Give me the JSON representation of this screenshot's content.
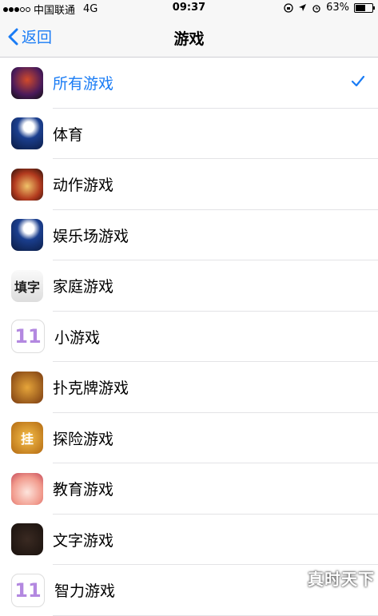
{
  "status": {
    "carrier": "中国联通",
    "network": "4G",
    "time": "09:37",
    "battery": "63%",
    "battery_level": 0.63
  },
  "nav": {
    "back_label": "返回",
    "title": "游戏"
  },
  "items": [
    {
      "label": "所有游戏",
      "icon": "all-games-icon",
      "selected": true
    },
    {
      "label": "体育",
      "icon": "sports-icon"
    },
    {
      "label": "动作游戏",
      "icon": "action-games-icon"
    },
    {
      "label": "娱乐场游戏",
      "icon": "casino-games-icon"
    },
    {
      "label": "家庭游戏",
      "icon": "family-games-icon",
      "glyph": "填字"
    },
    {
      "label": "小游戏",
      "icon": "mini-games-icon",
      "glyph": "11"
    },
    {
      "label": "扑克牌游戏",
      "icon": "card-games-icon"
    },
    {
      "label": "探险游戏",
      "icon": "adventure-games-icon",
      "glyph": "挂"
    },
    {
      "label": "教育游戏",
      "icon": "education-games-icon"
    },
    {
      "label": "文字游戏",
      "icon": "word-games-icon"
    },
    {
      "label": "智力游戏",
      "icon": "puzzle-games-icon",
      "glyph": "11"
    }
  ],
  "watermark": "真时天下",
  "colors": {
    "accent": "#1a7cf5",
    "background": "#efeff4"
  }
}
